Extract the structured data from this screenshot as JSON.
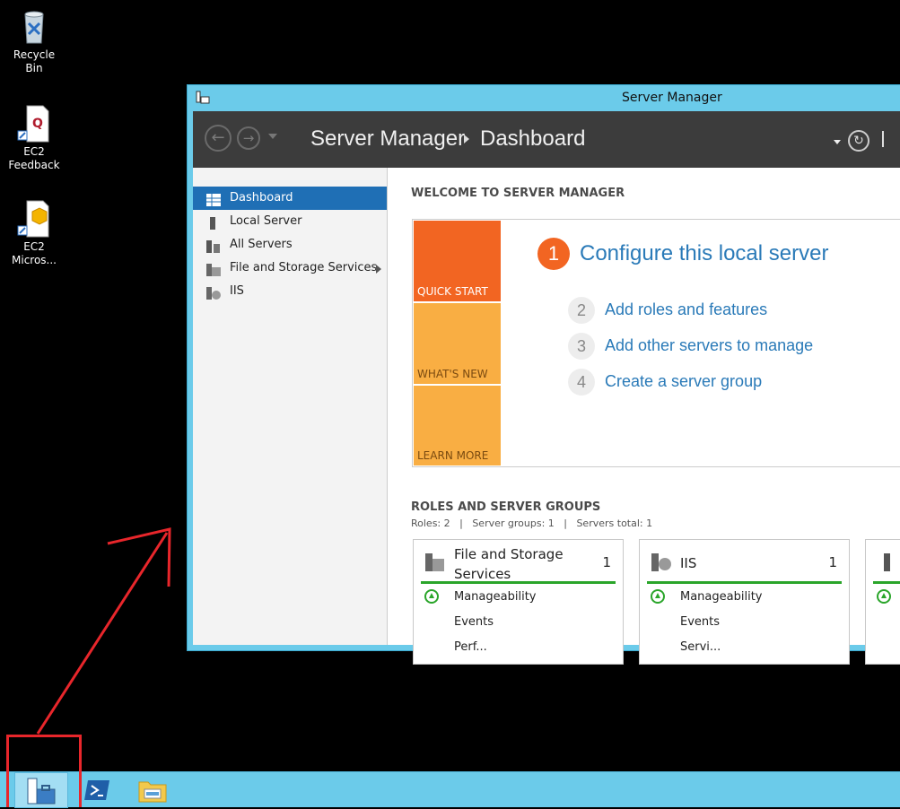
{
  "desktop": {
    "icons": [
      {
        "label": "Recycle Bin",
        "icon": "recycle-bin-icon"
      },
      {
        "label": "EC2\nFeedback",
        "icon": "ec2-feedback-icon"
      },
      {
        "label": "EC2\nMicros...",
        "icon": "ec2-microsoft-icon"
      }
    ]
  },
  "window": {
    "title": "Server Manager",
    "breadcrumb": {
      "root": "Server Manager",
      "current": "Dashboard"
    }
  },
  "sidebar": {
    "items": [
      {
        "label": "Dashboard",
        "icon": "dashboard-icon",
        "active": true
      },
      {
        "label": "Local Server",
        "icon": "local-server-icon"
      },
      {
        "label": "All Servers",
        "icon": "all-servers-icon"
      },
      {
        "label": "File and Storage Services",
        "icon": "file-storage-icon"
      },
      {
        "label": "IIS",
        "icon": "iis-icon"
      }
    ]
  },
  "welcome": {
    "heading": "WELCOME TO SERVER MANAGER",
    "tiles": [
      "QUICK START",
      "WHAT'S NEW",
      "LEARN MORE"
    ],
    "steps": [
      {
        "num": "1",
        "label": "Configure this local server"
      },
      {
        "num": "2",
        "label": "Add roles and features"
      },
      {
        "num": "3",
        "label": "Add other servers to manage"
      },
      {
        "num": "4",
        "label": "Create a server group"
      }
    ]
  },
  "roles": {
    "heading": "ROLES AND SERVER GROUPS",
    "summary": "Roles: 2   |   Server groups: 1   |   Servers total: 1",
    "cards": [
      {
        "title": "File and Storage\nServices",
        "count": "1",
        "rows": [
          "Manageability",
          "Events",
          "Perf..."
        ]
      },
      {
        "title": "IIS",
        "count": "1",
        "rows": [
          "Manageability",
          "Events",
          "Servi..."
        ]
      }
    ]
  },
  "taskbar": {
    "items": [
      "server-manager-icon",
      "powershell-icon",
      "file-explorer-icon"
    ]
  },
  "colors": {
    "accent_orange": "#f26522",
    "tile_light_orange": "#f9ae43",
    "nav_selected": "#1f6fb5",
    "window_chrome": "#6bcbea",
    "annotation_red": "#e8262b"
  }
}
